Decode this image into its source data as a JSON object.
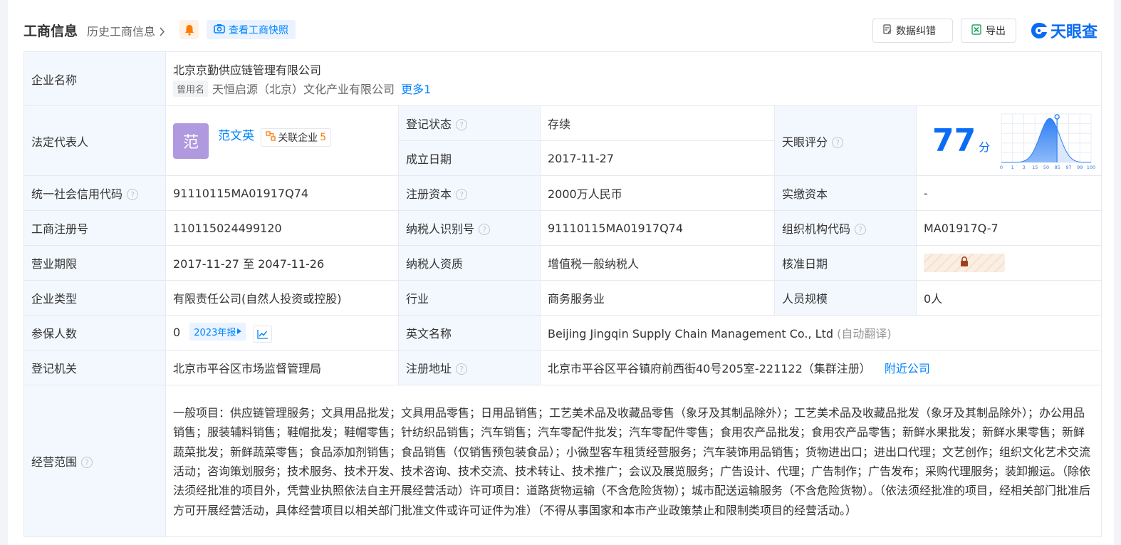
{
  "header": {
    "title": "工商信息",
    "history_link": "历史工商信息",
    "snapshot_button": "查看工商快照",
    "error_button": "数据纠错",
    "export_button": "导出",
    "logo_text": "天眼查"
  },
  "colors": {
    "accent": "#0084ff",
    "label_bg": "#f3f8ff",
    "status_green": "#22a045",
    "brand_blue": "#0a6cf5"
  },
  "company": {
    "name_label": "企业名称",
    "name": "北京京勤供应链管理有限公司",
    "former_tag": "曾用名",
    "former_name": "天恒启源（北京）文化产业有限公司",
    "more_link": "更多1"
  },
  "legal_rep": {
    "label": "法定代表人",
    "avatar_char": "范",
    "name": "范文英",
    "related_label": "关联企业",
    "related_count": "5"
  },
  "status": {
    "label": "登记状态",
    "value": "存续"
  },
  "founded": {
    "label": "成立日期",
    "value": "2017-11-27"
  },
  "score": {
    "label": "天眼评分",
    "value": "77",
    "unit": "分",
    "axis_ticks": [
      "0",
      "1",
      "3",
      "15",
      "50",
      "85",
      "97",
      "99",
      "100"
    ]
  },
  "credit_code": {
    "label": "统一社会信用代码",
    "value": "91110115MA01917Q74"
  },
  "reg_capital": {
    "label": "注册资本",
    "value": "2000万人民币"
  },
  "paid_capital": {
    "label": "实缴资本",
    "value": "-"
  },
  "reg_number": {
    "label": "工商注册号",
    "value": "110115024499120"
  },
  "taxpayer_id": {
    "label": "纳税人识别号",
    "value": "91110115MA01917Q74"
  },
  "org_code": {
    "label": "组织机构代码",
    "value": "MA01917Q-7"
  },
  "biz_term": {
    "label": "营业期限",
    "value": "2017-11-27 至 2047-11-26"
  },
  "tax_quality": {
    "label": "纳税人资质",
    "value": "增值税一般纳税人"
  },
  "approval_date": {
    "label": "核准日期"
  },
  "company_type": {
    "label": "企业类型",
    "value": "有限责任公司(自然人投资或控股)"
  },
  "industry": {
    "label": "行业",
    "value": "商务服务业"
  },
  "staff_size": {
    "label": "人员规模",
    "value": "0人"
  },
  "insured": {
    "label": "参保人数",
    "value": "0",
    "report_tag": "2023年报"
  },
  "english_name": {
    "label": "英文名称",
    "value": "Beijing Jingqin Supply Chain Management Co., Ltd",
    "note": "(自动翻译)"
  },
  "reg_authority": {
    "label": "登记机关",
    "value": "北京市平谷区市场监督管理局"
  },
  "reg_address": {
    "label": "注册地址",
    "value": "北京市平谷区平谷镇府前西街40号205室-221122（集群注册）",
    "nearby_link": "附近公司"
  },
  "scope": {
    "label": "经营范围",
    "value": "一般项目：供应链管理服务；文具用品批发；文具用品零售；日用品销售；工艺美术品及收藏品零售（象牙及其制品除外）；工艺美术品及收藏品批发（象牙及其制品除外）；办公用品销售；服装辅料销售；鞋帽批发；鞋帽零售；针纺织品销售；汽车销售；汽车零配件批发；汽车零配件零售；食用农产品批发；食用农产品零售；新鲜水果批发；新鲜水果零售；新鲜蔬菜批发；新鲜蔬菜零售；食品添加剂销售；食品销售（仅销售预包装食品）；小微型客车租赁经营服务；汽车装饰用品销售；货物进出口；进出口代理；文艺创作；组织文化艺术交流活动；咨询策划服务；技术服务、技术开发、技术咨询、技术交流、技术转让、技术推广；会议及展览服务；广告设计、代理；广告制作；广告发布；采购代理服务；装卸搬运。（除依法须经批准的项目外，凭营业执照依法自主开展经营活动）许可项目：道路货物运输（不含危险货物）；城市配送运输服务（不含危险货物）。（依法须经批准的项目，经相关部门批准后方可开展经营活动，具体经营项目以相关部门批准文件或许可证件为准）（不得从事国家和本市产业政策禁止和限制类项目的经营活动。）"
  }
}
